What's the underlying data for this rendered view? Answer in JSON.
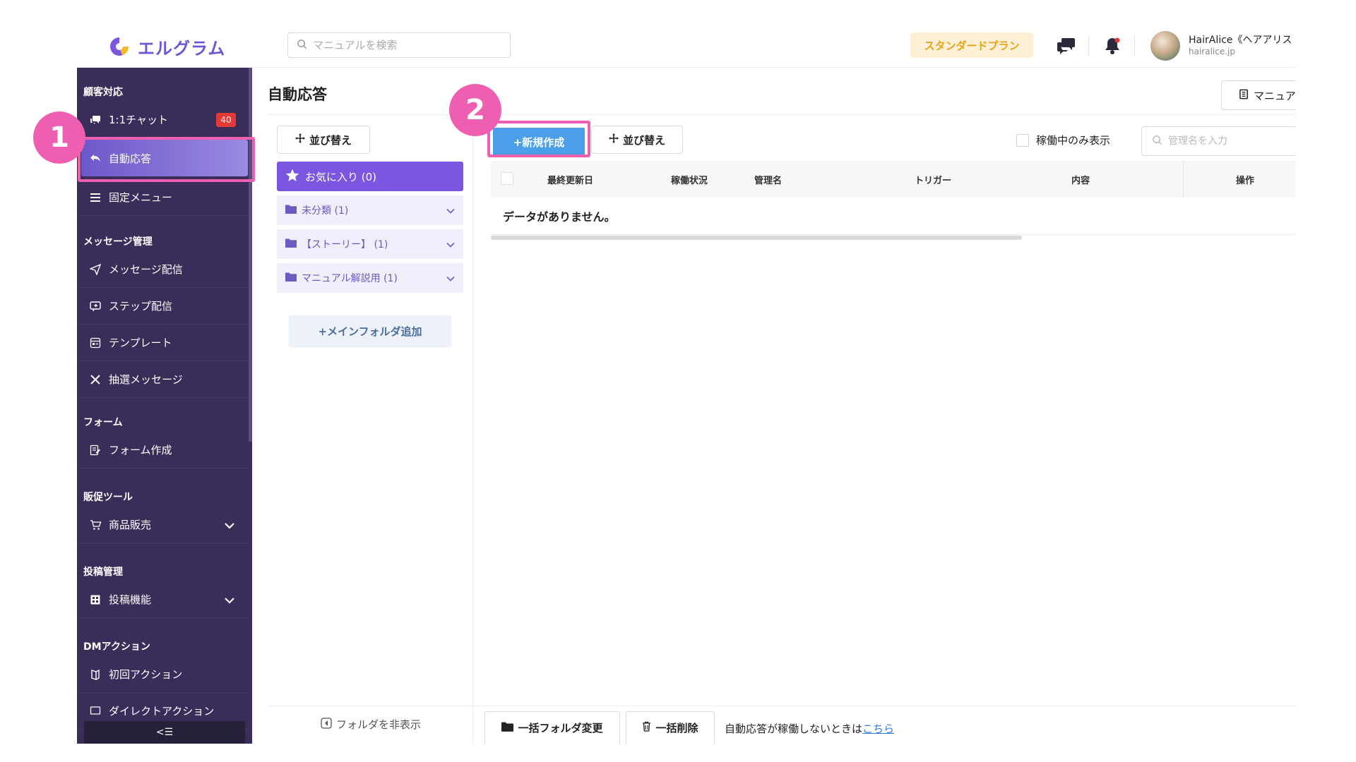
{
  "header": {
    "logo_text": "エルグラム",
    "search_placeholder": "マニュアルを検索",
    "plan_label": "スタンダードプラン",
    "user_name": "HairAlice《ヘアアリス",
    "user_domain": "hairalice.jp"
  },
  "sidebar": {
    "sections": [
      {
        "title": "顧客対応"
      },
      {
        "title": "メッセージ管理"
      },
      {
        "title": "フォーム"
      },
      {
        "title": "販促ツール"
      },
      {
        "title": "投稿管理"
      },
      {
        "title": "DMアクション"
      }
    ],
    "items": {
      "chat": {
        "label": "1:1チャット",
        "badge": "40"
      },
      "auto_reply": {
        "label": "自動応答"
      },
      "fixed_menu": {
        "label": "固定メニュー"
      },
      "message_delivery": {
        "label": "メッセージ配信"
      },
      "step_delivery": {
        "label": "ステップ配信"
      },
      "template": {
        "label": "テンプレート"
      },
      "lottery": {
        "label": "抽選メッセージ"
      },
      "form_create": {
        "label": "フォーム作成"
      },
      "product_sales": {
        "label": "商品販売"
      },
      "post_feature": {
        "label": "投稿機能"
      },
      "first_action": {
        "label": "初回アクション"
      },
      "direct_action": {
        "label": "ダイレクトアクション"
      }
    },
    "collapse_label": "<☰"
  },
  "page": {
    "title": "自動応答",
    "manual_button": "マニュア"
  },
  "folders": {
    "sort_button": "並び替え",
    "favorite": "お気に入り (0)",
    "items": [
      "未分類 (1)",
      "【ストーリー】 (1)",
      "マニュアル解説用 (1)"
    ],
    "add_main_folder": "+メインフォルダ追加",
    "hide_folders": "フォルダを非表示"
  },
  "toolbar": {
    "new_button": "+新規作成",
    "sort_button": "並び替え",
    "active_only_label": "稼働中のみ表示",
    "name_search_placeholder": "管理名を入力"
  },
  "table": {
    "columns": [
      "最終更新日",
      "稼働状況",
      "管理名",
      "トリガー",
      "内容",
      "操作"
    ],
    "empty_message": "データがありません。"
  },
  "footer": {
    "bulk_folder_change": "一括フォルダ変更",
    "bulk_delete": "一括削除",
    "note_prefix": "自動応答が稼働しないときは",
    "note_link": "こちら"
  },
  "annotations": {
    "step1": "1",
    "step2": "2"
  },
  "colors": {
    "sidebar_bg": "#3a2d5a",
    "accent_purple": "#7b56e0",
    "highlight_pink": "#ee5fb2",
    "primary_blue": "#4b9ee8",
    "plan_text": "#e8a317"
  }
}
